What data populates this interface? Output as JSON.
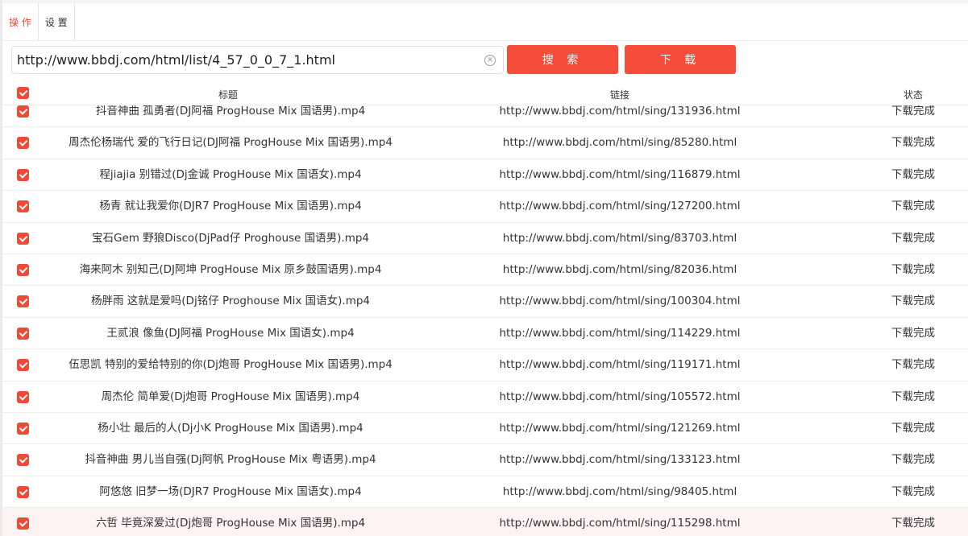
{
  "tabs": [
    {
      "label": "操 作",
      "active": true
    },
    {
      "label": "设 置",
      "active": false
    }
  ],
  "url_input": {
    "value": "http://www.bbdj.com/html/list/4_57_0_0_7_1.html"
  },
  "buttons": {
    "search": "搜 索",
    "download": "下 载"
  },
  "table": {
    "headers": {
      "title": "标题",
      "link": "链接",
      "status": "状态"
    },
    "rows": [
      {
        "title": "抖音神曲 孤勇者(DJ阿福 ProgHouse Mix 国语男).mp4",
        "link": "http://www.bbdj.com/html/sing/131936.html",
        "status": "下载完成"
      },
      {
        "title": "周杰伦杨瑞代 爱的飞行日记(DJ阿福 ProgHouse Mix 国语男).mp4",
        "link": "http://www.bbdj.com/html/sing/85280.html",
        "status": "下载完成"
      },
      {
        "title": "程jiajia 别错过(Dj金诚 ProgHouse Mix 国语女).mp4",
        "link": "http://www.bbdj.com/html/sing/116879.html",
        "status": "下载完成"
      },
      {
        "title": "杨青 就让我爱你(DJR7 ProgHouse Mix 国语男).mp4",
        "link": "http://www.bbdj.com/html/sing/127200.html",
        "status": "下载完成"
      },
      {
        "title": "宝石Gem 野狼Disco(DjPad仔 Proghouse 国语男).mp4",
        "link": "http://www.bbdj.com/html/sing/83703.html",
        "status": "下载完成"
      },
      {
        "title": "海来阿木 别知己(DJ阿坤 ProgHouse Mix 原乡鼓国语男).mp4",
        "link": "http://www.bbdj.com/html/sing/82036.html",
        "status": "下载完成"
      },
      {
        "title": "杨胖雨 这就是爱吗(Dj铭仔 Proghouse Mix 国语女).mp4",
        "link": "http://www.bbdj.com/html/sing/100304.html",
        "status": "下载完成"
      },
      {
        "title": "王贰浪 像鱼(DJ阿福 ProgHouse Mix 国语女).mp4",
        "link": "http://www.bbdj.com/html/sing/114229.html",
        "status": "下载完成"
      },
      {
        "title": "伍思凯 特别的爱给特别的你(Dj炮哥 ProgHouse Mix 国语男).mp4",
        "link": "http://www.bbdj.com/html/sing/119171.html",
        "status": "下载完成"
      },
      {
        "title": "周杰伦 简单爱(Dj炮哥 ProgHouse Mix 国语男).mp4",
        "link": "http://www.bbdj.com/html/sing/105572.html",
        "status": "下载完成"
      },
      {
        "title": "杨小壮 最后的人(Dj小K ProgHouse Mix 国语男).mp4",
        "link": "http://www.bbdj.com/html/sing/121269.html",
        "status": "下载完成"
      },
      {
        "title": "抖音神曲 男儿当自强(Dj阿帆 ProgHouse Mix 粤语男).mp4",
        "link": "http://www.bbdj.com/html/sing/133123.html",
        "status": "下载完成"
      },
      {
        "title": "阿悠悠 旧梦一场(DJR7 ProgHouse Mix 国语女).mp4",
        "link": "http://www.bbdj.com/html/sing/98405.html",
        "status": "下载完成"
      },
      {
        "title": "六哲 毕竟深爱过(Dj炮哥 ProgHouse Mix 国语男).mp4",
        "link": "http://www.bbdj.com/html/sing/115298.html",
        "status": "下载完成"
      }
    ]
  },
  "colors": {
    "accent": "#f64c3a",
    "checkbox": "#f04a37",
    "row_highlight": "#fdf3f2"
  }
}
